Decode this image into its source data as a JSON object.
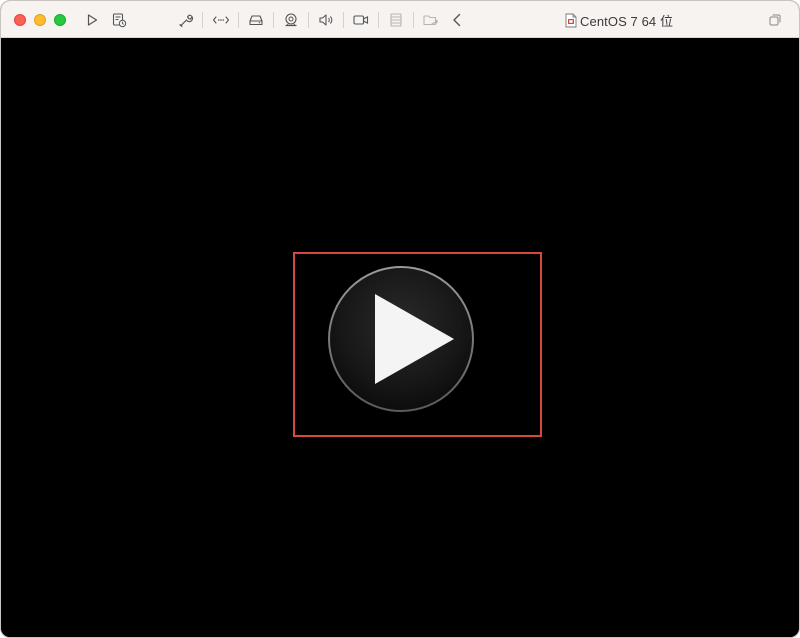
{
  "window": {
    "title": "CentOS 7 64 位"
  },
  "toolbar": {
    "icons": [
      "play-icon",
      "snapshot-icon",
      "wrench-icon",
      "network-icon",
      "disk-icon",
      "camera-icon",
      "speaker-icon",
      "video-icon",
      "storage-icon",
      "shared-folder-icon",
      "back-chevron-icon",
      "window-restore-icon"
    ]
  },
  "colors": {
    "titlebar": "#f6f3f1",
    "screen": "#000000",
    "highlight_frame": "#d9483b",
    "close": "#ff5f57",
    "minimize": "#febc2e",
    "zoom": "#28c840"
  }
}
